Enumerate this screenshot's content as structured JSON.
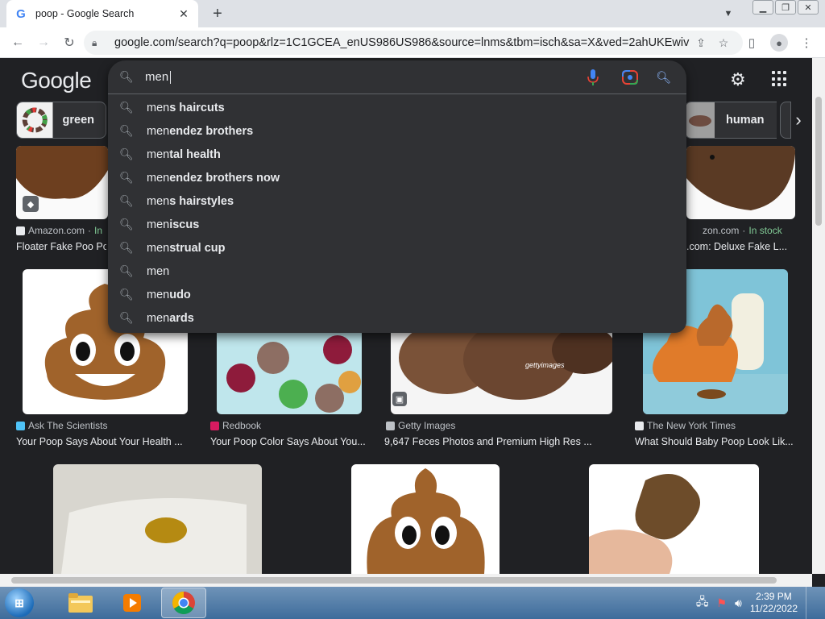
{
  "browser": {
    "tab_title": "poop - Google Search",
    "url": "google.com/search?q=poop&rlz=1C1GCEA_enUS986US986&source=lnms&tbm=isch&sa=X&ved=2ahUKEwiv1..."
  },
  "google": {
    "logo": "Google"
  },
  "chips": [
    {
      "label": "green"
    },
    {
      "label": "human"
    }
  ],
  "search": {
    "typed": "men"
  },
  "suggestions": [
    {
      "prefix": "men",
      "rest": "s haircuts"
    },
    {
      "prefix": "men",
      "rest": "endez brothers"
    },
    {
      "prefix": "men",
      "rest": "tal health"
    },
    {
      "prefix": "men",
      "rest": "endez brothers now"
    },
    {
      "prefix": "men",
      "rest": "s hairstyles"
    },
    {
      "prefix": "men",
      "rest": "iscus"
    },
    {
      "prefix": "men",
      "rest": "strual cup"
    },
    {
      "prefix": "men",
      "rest": ""
    },
    {
      "prefix": "men",
      "rest": "udo"
    },
    {
      "prefix": "men",
      "rest": "ards"
    }
  ],
  "results": {
    "row1_left": {
      "source": "Amazon.com",
      "sep": "·",
      "stock": "In",
      "caption": "Floater Fake Poo Po"
    },
    "row1_right": {
      "source": "zon.com",
      "sep": "·",
      "stock": "In stock",
      "caption": ".com: Deluxe Fake L..."
    },
    "row2": [
      {
        "source": "Ask The Scientists",
        "caption": "Your Poop Says About Your Health ...",
        "icon_color": "#4fc3f7"
      },
      {
        "source": "Redbook",
        "caption": "Your Poop Color Says About You...",
        "icon_color": "#d81b60"
      },
      {
        "source": "Getty Images",
        "caption": "9,647 Feces Photos and Premium High Res ...",
        "icon_color": "#bdc1c6"
      },
      {
        "source": "The New York Times",
        "caption": "What Should Baby Poop Look Lik...",
        "icon_color": "#e8eaed"
      }
    ],
    "getty_watermark": "gettyimages"
  },
  "taskbar": {
    "time": "2:39 PM",
    "date": "11/22/2022"
  }
}
